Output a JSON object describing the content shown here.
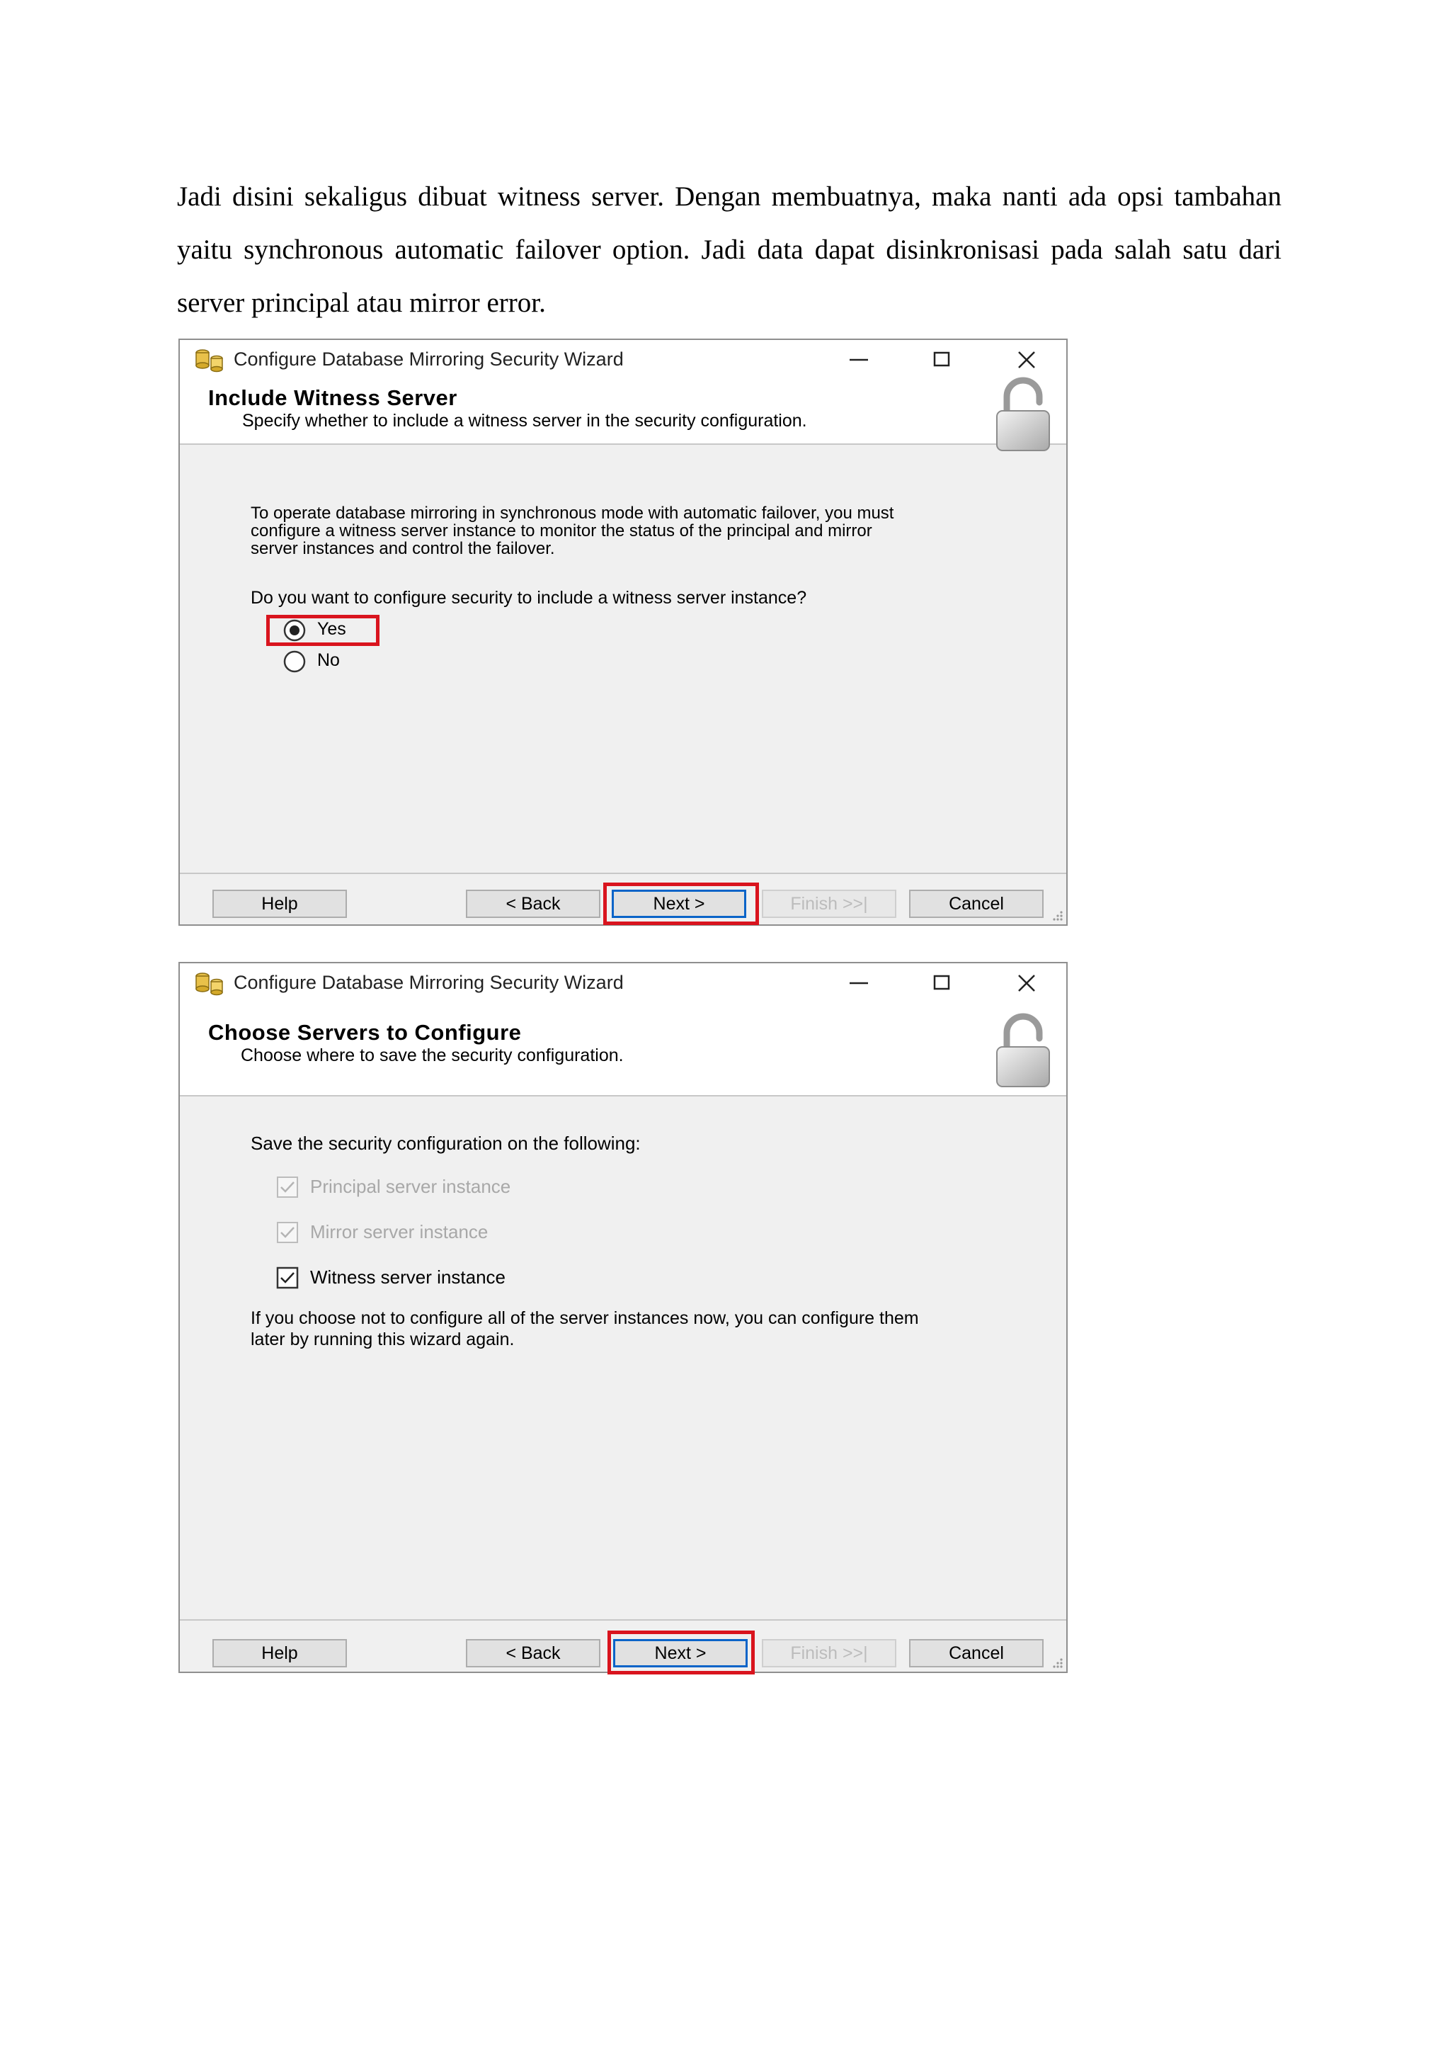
{
  "paragraph": "Jadi disini sekaligus dibuat witness server. Dengan membuatnya, maka nanti ada opsi tambahan yaitu synchronous automatic failover option. Jadi data dapat disinkronisasi pada salah satu dari server principal atau mirror error.",
  "wizard1": {
    "title": "Configure Database Mirroring Security Wizard",
    "header_title": "Include Witness Server",
    "header_subtitle": "Specify whether to include a witness server in the security configuration.",
    "description_lines": [
      "To operate database mirroring in synchronous mode with automatic failover, you must",
      "configure a witness server instance to monitor the status of the principal and mirror",
      "server instances and control the failover."
    ],
    "question": "Do you want to configure security to include a witness server instance?",
    "options": [
      {
        "label": "Yes",
        "selected": true
      },
      {
        "label": "No",
        "selected": false
      }
    ],
    "buttons": {
      "help": "Help",
      "back": "< Back",
      "next": "Next >",
      "finish": "Finish >>|",
      "cancel": "Cancel"
    }
  },
  "wizard2": {
    "title": "Configure Database Mirroring Security Wizard",
    "header_title": "Choose Servers to Configure",
    "header_subtitle": "Choose where to save the security configuration.",
    "prompt": "Save the security configuration on the following:",
    "checkboxes": [
      {
        "label": "Principal server instance",
        "checked": true,
        "enabled": false
      },
      {
        "label": "Mirror server instance",
        "checked": true,
        "enabled": false
      },
      {
        "label": "Witness server instance",
        "checked": true,
        "enabled": true
      }
    ],
    "note_lines": [
      "If you choose not to configure all of the server instances now, you can configure them",
      "later by running this wizard again."
    ],
    "buttons": {
      "help": "Help",
      "back": "< Back",
      "next": "Next >",
      "finish": "Finish >>|",
      "cancel": "Cancel"
    }
  },
  "colors": {
    "highlight": "#d9141e",
    "primary_border": "#0a64c8",
    "dialog_bg": "#f0f0f0"
  }
}
